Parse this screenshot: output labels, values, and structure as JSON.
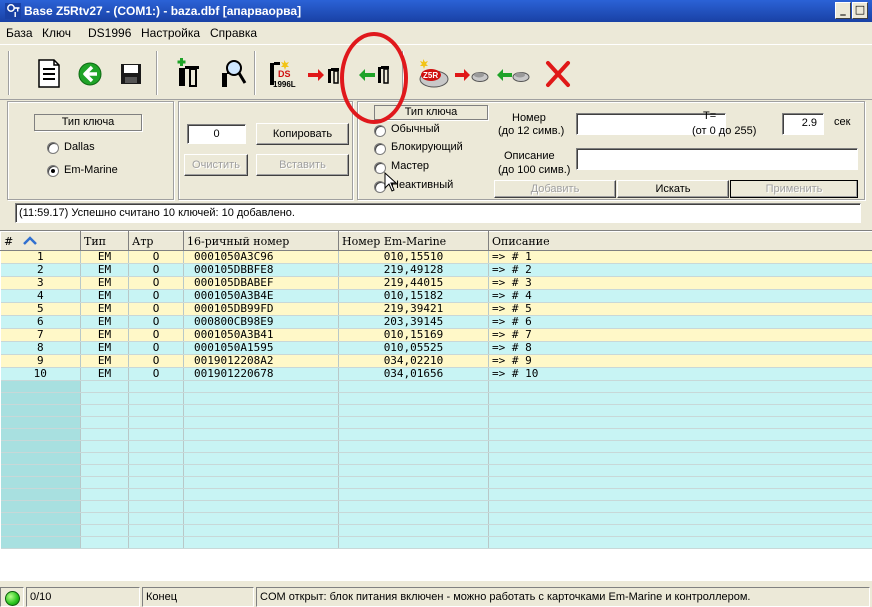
{
  "window": {
    "title": "Base Z5Rtv27 - (COM1:) - baza.dbf [апарваорва]",
    "min_label": "_",
    "max_label": "□"
  },
  "menu": [
    "База",
    "Ключ",
    "DS1996",
    "Настройка",
    "Справка"
  ],
  "toolbar": {
    "icons": [
      "new-document-icon",
      "go-forward-icon",
      "save-icon",
      "add-key-icon",
      "search-key-icon",
      "ds1996-icon",
      "write-key-icon",
      "read-key-icon",
      "z5r-icon",
      "write-z5r-icon",
      "read-z5r-icon",
      "delete-icon"
    ],
    "ds_label": "DS",
    "ds_sub": "1996L",
    "z5r_label": "Z5R",
    "highlight_color": "#e0181c"
  },
  "key_type_panel": {
    "title": "Тип ключа",
    "options": [
      "Dallas",
      "Em-Marine"
    ],
    "selected": "Em-Marine"
  },
  "copy_panel": {
    "count": "0",
    "copy_label": "Копировать",
    "clear_label": "Очистить",
    "paste_label": "Вставить"
  },
  "key_mode_panel": {
    "title": "Тип ключа",
    "options": [
      "Обычный",
      "Блокирующий",
      "Мастер",
      "Неактивный"
    ]
  },
  "edit_panel": {
    "number_label": "Номер",
    "number_hint": "(до 12 симв.)",
    "number_value": "",
    "t_label": "T=",
    "t_hint": "(от 0 до 255)",
    "t_value": "2.9",
    "t_unit": "сек",
    "desc_label": "Описание",
    "desc_hint": "(до 100 симв.)",
    "desc_value": "",
    "add_label": "Добавить",
    "find_label": "Искать",
    "apply_label": "Применить"
  },
  "status_line": "(11:59.17) Успешно считано 10 ключей: 10 добавлено.",
  "table": {
    "headers": [
      "#",
      "Тип",
      "Атр",
      "16-ричный номер",
      "Номер Em-Marine",
      "Описание"
    ],
    "rows": [
      [
        "1",
        "EM",
        "O",
        "0001050A3C96",
        "010,15510",
        "=> # 1"
      ],
      [
        "2",
        "EM",
        "O",
        "000105DBBFE8",
        "219,49128",
        "=> # 2"
      ],
      [
        "3",
        "EM",
        "O",
        "000105DBABEF",
        "219,44015",
        "=> # 3"
      ],
      [
        "4",
        "EM",
        "O",
        "0001050A3B4E",
        "010,15182",
        "=> # 4"
      ],
      [
        "5",
        "EM",
        "O",
        "000105DB99FD",
        "219,39421",
        "=> # 5"
      ],
      [
        "6",
        "EM",
        "O",
        "000800CB98E9",
        "203,39145",
        "=> # 6"
      ],
      [
        "7",
        "EM",
        "O",
        "0001050A3B41",
        "010,15169",
        "=> # 7"
      ],
      [
        "8",
        "EM",
        "O",
        "0001050A1595",
        "010,05525",
        "=> # 8"
      ],
      [
        "9",
        "EM",
        "O",
        "0019012208A2",
        "034,02210",
        "=> # 9"
      ],
      [
        "10",
        "EM",
        "O",
        "001901220678",
        "034,01656",
        "=> # 10"
      ]
    ],
    "row_colors": {
      "odd": "#fff8c8",
      "even": "#c8f4f4"
    }
  },
  "statusbar": {
    "led_color": "#27c41c",
    "count": "0/10",
    "state": "Конец",
    "message": "COM открыт: блок питания включен - можно работать с карточками Em-Marine и контроллером."
  }
}
